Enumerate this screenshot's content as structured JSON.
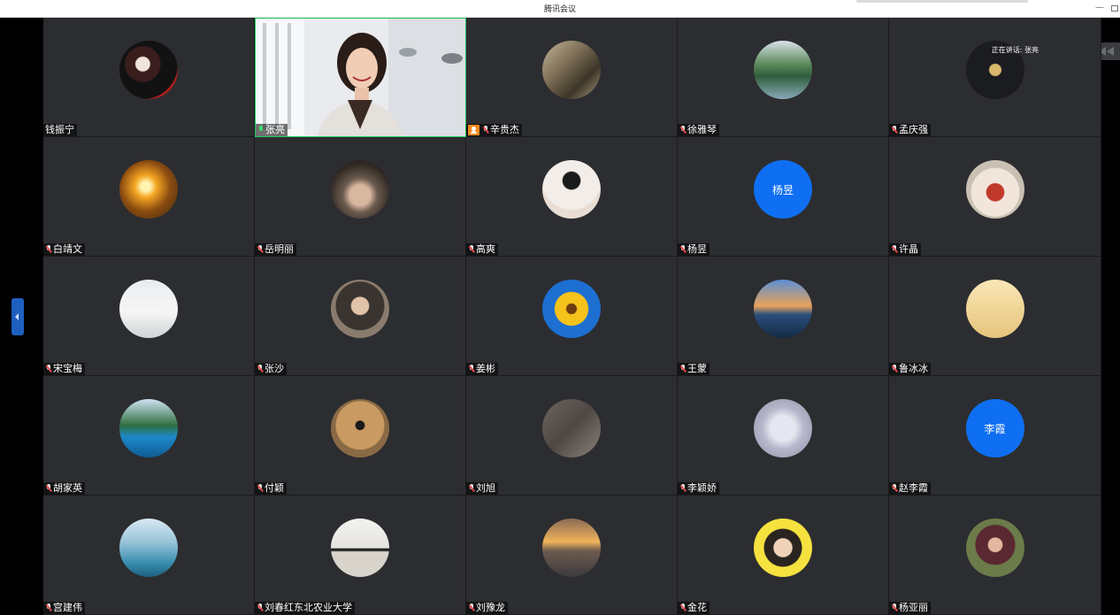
{
  "app": {
    "title": "腾讯会议"
  },
  "speaking_indicator": "正在讲话: 张亮",
  "colors": {
    "tile_bg": "#2c2d30",
    "active_border": "#22c55e",
    "letter_avatar": "#0f6ff2",
    "host_badge": "#f28a1c",
    "mic_muted": "#e34b4b",
    "mic_on": "#3ddc6c"
  },
  "participants": [
    {
      "name": "钱振宁",
      "mic": "none",
      "avatar": "art-red"
    },
    {
      "name": "张亮",
      "mic": "on",
      "avatar": "video",
      "active": true
    },
    {
      "name": "辛贵杰",
      "mic": "muted",
      "avatar": "street",
      "host": true
    },
    {
      "name": "徐雅琴",
      "mic": "muted",
      "avatar": "lake"
    },
    {
      "name": "孟庆强",
      "mic": "muted",
      "avatar": "dark-logo"
    },
    {
      "name": "白靖文",
      "mic": "muted",
      "avatar": "sunset-leaves"
    },
    {
      "name": "岳明丽",
      "mic": "muted",
      "avatar": "fur-hood"
    },
    {
      "name": "高爽",
      "mic": "muted",
      "avatar": "girl-light"
    },
    {
      "name": "杨昱",
      "mic": "muted",
      "avatar": "letter",
      "letter": "杨昱"
    },
    {
      "name": "许晶",
      "mic": "muted",
      "avatar": "kid"
    },
    {
      "name": "宋宝梅",
      "mic": "muted",
      "avatar": "white-building"
    },
    {
      "name": "张沙",
      "mic": "muted",
      "avatar": "glasses-man"
    },
    {
      "name": "姜彬",
      "mic": "muted",
      "avatar": "sunflower"
    },
    {
      "name": "王蒙",
      "mic": "muted",
      "avatar": "sea-sunset"
    },
    {
      "name": "鲁冰冰",
      "mic": "muted",
      "avatar": "beach-run"
    },
    {
      "name": "胡家英",
      "mic": "muted",
      "avatar": "palms-pool"
    },
    {
      "name": "付颖",
      "mic": "muted",
      "avatar": "teddy"
    },
    {
      "name": "刘旭",
      "mic": "muted",
      "avatar": "shadow"
    },
    {
      "name": "李颖娇",
      "mic": "muted",
      "avatar": "flowers"
    },
    {
      "name": "赵李霞",
      "mic": "muted",
      "avatar": "letter",
      "letter": "李霞"
    },
    {
      "name": "宫建伟",
      "mic": "muted",
      "avatar": "dolphins"
    },
    {
      "name": "刘春红东北农业大学",
      "mic": "muted",
      "avatar": "standing-woman"
    },
    {
      "name": "刘豫龙",
      "mic": "muted",
      "avatar": "ocean-sunrise"
    },
    {
      "name": "金花",
      "mic": "muted",
      "avatar": "girl-eating"
    },
    {
      "name": "杨亚丽",
      "mic": "muted",
      "avatar": "woman-red"
    }
  ]
}
